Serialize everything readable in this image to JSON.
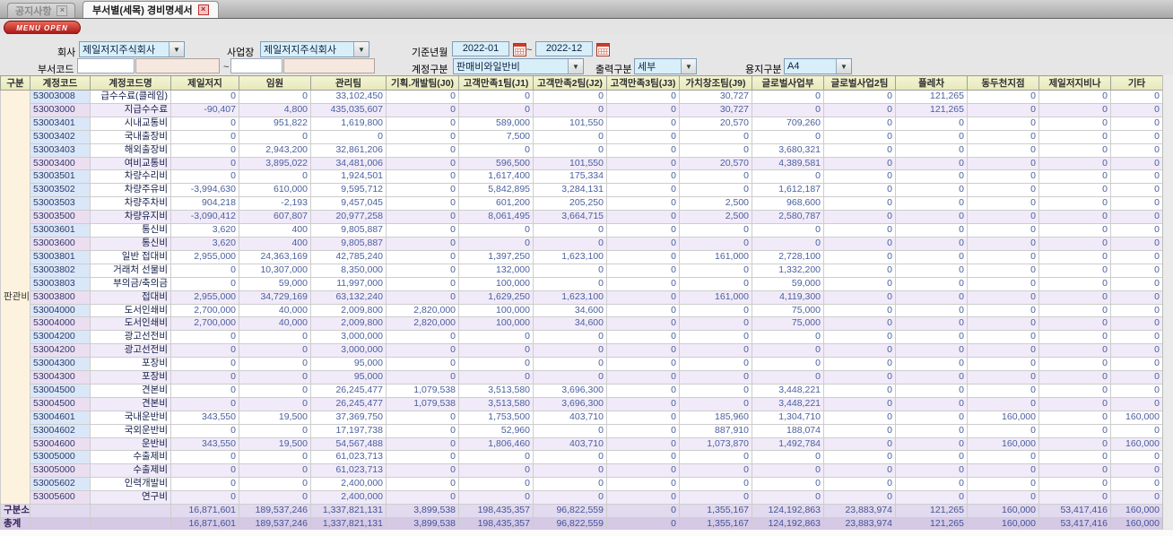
{
  "tabs": [
    {
      "label": "공지사항",
      "active": false
    },
    {
      "label": "부서별(세목) 경비명세서",
      "active": true
    }
  ],
  "menu_button": "MENU OPEN",
  "filters": {
    "company_label": "회사",
    "company_value": "제일저지주식회사",
    "site_label": "사업장",
    "site_value": "제일저지주식회사",
    "period_label": "기준년월",
    "period_from": "2022-01",
    "period_to": "2022-12",
    "tilde": "~",
    "dept_label": "부서코드",
    "account_label": "계정구분",
    "account_value": "판매비와일반비",
    "output_label": "출력구분",
    "output_value": "세부",
    "paper_label": "용지구분",
    "paper_value": "A4"
  },
  "table": {
    "columns": [
      "구분",
      "계정코드",
      "계정코드명",
      "제일저지",
      "임원",
      "관리팀",
      "기획.개발팀(J0)",
      "고객만족1팀(J1)",
      "고객만족2팀(J2)",
      "고객만족3팀(J3)",
      "가치창조팀(J9)",
      "글로벌사업부",
      "글로벌사업2팀",
      "플레차",
      "동두천지점",
      "제일저지비나",
      "기타"
    ],
    "group_label": "판관비",
    "rows": [
      {
        "code": "53003008",
        "name": "급수수료(클레임)",
        "type": "n",
        "values": [
          "0",
          "0",
          "33,102,450",
          "0",
          "0",
          "0",
          "0",
          "30,727",
          "0",
          "0",
          "121,265",
          "0",
          "0",
          "0"
        ]
      },
      {
        "code": "53003000",
        "name": "지급수수료",
        "type": "s",
        "values": [
          "-90,407",
          "4,800",
          "435,035,607",
          "0",
          "0",
          "0",
          "0",
          "30,727",
          "0",
          "0",
          "121,265",
          "0",
          "0",
          "0"
        ]
      },
      {
        "code": "53003401",
        "name": "시내교통비",
        "type": "n",
        "values": [
          "0",
          "951,822",
          "1,619,800",
          "0",
          "589,000",
          "101,550",
          "0",
          "20,570",
          "709,260",
          "0",
          "0",
          "0",
          "0",
          "0"
        ]
      },
      {
        "code": "53003402",
        "name": "국내출장비",
        "type": "n",
        "values": [
          "0",
          "0",
          "0",
          "0",
          "7,500",
          "0",
          "0",
          "0",
          "0",
          "0",
          "0",
          "0",
          "0",
          "0"
        ]
      },
      {
        "code": "53003403",
        "name": "해외출장비",
        "type": "n",
        "values": [
          "0",
          "2,943,200",
          "32,861,206",
          "0",
          "0",
          "0",
          "0",
          "0",
          "3,680,321",
          "0",
          "0",
          "0",
          "0",
          "0"
        ]
      },
      {
        "code": "53003400",
        "name": "여비교통비",
        "type": "s",
        "values": [
          "0",
          "3,895,022",
          "34,481,006",
          "0",
          "596,500",
          "101,550",
          "0",
          "20,570",
          "4,389,581",
          "0",
          "0",
          "0",
          "0",
          "0"
        ]
      },
      {
        "code": "53003501",
        "name": "차량수리비",
        "type": "n",
        "values": [
          "0",
          "0",
          "1,924,501",
          "0",
          "1,617,400",
          "175,334",
          "0",
          "0",
          "0",
          "0",
          "0",
          "0",
          "0",
          "0"
        ]
      },
      {
        "code": "53003502",
        "name": "차량주유비",
        "type": "n",
        "values": [
          "-3,994,630",
          "610,000",
          "9,595,712",
          "0",
          "5,842,895",
          "3,284,131",
          "0",
          "0",
          "1,612,187",
          "0",
          "0",
          "0",
          "0",
          "0"
        ]
      },
      {
        "code": "53003503",
        "name": "차량주차비",
        "type": "n",
        "values": [
          "904,218",
          "-2,193",
          "9,457,045",
          "0",
          "601,200",
          "205,250",
          "0",
          "2,500",
          "968,600",
          "0",
          "0",
          "0",
          "0",
          "0"
        ]
      },
      {
        "code": "53003500",
        "name": "차량유지비",
        "type": "s",
        "values": [
          "-3,090,412",
          "607,807",
          "20,977,258",
          "0",
          "8,061,495",
          "3,664,715",
          "0",
          "2,500",
          "2,580,787",
          "0",
          "0",
          "0",
          "0",
          "0"
        ]
      },
      {
        "code": "53003601",
        "name": "통신비",
        "type": "n",
        "values": [
          "3,620",
          "400",
          "9,805,887",
          "0",
          "0",
          "0",
          "0",
          "0",
          "0",
          "0",
          "0",
          "0",
          "0",
          "0"
        ]
      },
      {
        "code": "53003600",
        "name": "통신비",
        "type": "s",
        "values": [
          "3,620",
          "400",
          "9,805,887",
          "0",
          "0",
          "0",
          "0",
          "0",
          "0",
          "0",
          "0",
          "0",
          "0",
          "0"
        ]
      },
      {
        "code": "53003801",
        "name": "일반 접대비",
        "type": "n",
        "values": [
          "2,955,000",
          "24,363,169",
          "42,785,240",
          "0",
          "1,397,250",
          "1,623,100",
          "0",
          "161,000",
          "2,728,100",
          "0",
          "0",
          "0",
          "0",
          "0"
        ]
      },
      {
        "code": "53003802",
        "name": "거래처 선물비",
        "type": "n",
        "values": [
          "0",
          "10,307,000",
          "8,350,000",
          "0",
          "132,000",
          "0",
          "0",
          "0",
          "1,332,200",
          "0",
          "0",
          "0",
          "0",
          "0"
        ]
      },
      {
        "code": "53003803",
        "name": "부의금/축의금",
        "type": "n",
        "values": [
          "0",
          "59,000",
          "11,997,000",
          "0",
          "100,000",
          "0",
          "0",
          "0",
          "59,000",
          "0",
          "0",
          "0",
          "0",
          "0"
        ]
      },
      {
        "code": "53003800",
        "name": "접대비",
        "type": "s",
        "values": [
          "2,955,000",
          "34,729,169",
          "63,132,240",
          "0",
          "1,629,250",
          "1,623,100",
          "0",
          "161,000",
          "4,119,300",
          "0",
          "0",
          "0",
          "0",
          "0"
        ]
      },
      {
        "code": "53004000",
        "name": "도서인쇄비",
        "type": "n",
        "values": [
          "2,700,000",
          "40,000",
          "2,009,800",
          "2,820,000",
          "100,000",
          "34,600",
          "0",
          "0",
          "75,000",
          "0",
          "0",
          "0",
          "0",
          "0"
        ]
      },
      {
        "code": "53004000",
        "name": "도서인쇄비",
        "type": "s",
        "values": [
          "2,700,000",
          "40,000",
          "2,009,800",
          "2,820,000",
          "100,000",
          "34,600",
          "0",
          "0",
          "75,000",
          "0",
          "0",
          "0",
          "0",
          "0"
        ]
      },
      {
        "code": "53004200",
        "name": "광고선전비",
        "type": "n",
        "values": [
          "0",
          "0",
          "3,000,000",
          "0",
          "0",
          "0",
          "0",
          "0",
          "0",
          "0",
          "0",
          "0",
          "0",
          "0"
        ]
      },
      {
        "code": "53004200",
        "name": "광고선전비",
        "type": "s",
        "values": [
          "0",
          "0",
          "3,000,000",
          "0",
          "0",
          "0",
          "0",
          "0",
          "0",
          "0",
          "0",
          "0",
          "0",
          "0"
        ]
      },
      {
        "code": "53004300",
        "name": "포장비",
        "type": "n",
        "values": [
          "0",
          "0",
          "95,000",
          "0",
          "0",
          "0",
          "0",
          "0",
          "0",
          "0",
          "0",
          "0",
          "0",
          "0"
        ]
      },
      {
        "code": "53004300",
        "name": "포장비",
        "type": "s",
        "values": [
          "0",
          "0",
          "95,000",
          "0",
          "0",
          "0",
          "0",
          "0",
          "0",
          "0",
          "0",
          "0",
          "0",
          "0"
        ]
      },
      {
        "code": "53004500",
        "name": "견본비",
        "type": "n",
        "values": [
          "0",
          "0",
          "26,245,477",
          "1,079,538",
          "3,513,580",
          "3,696,300",
          "0",
          "0",
          "3,448,221",
          "0",
          "0",
          "0",
          "0",
          "0"
        ]
      },
      {
        "code": "53004500",
        "name": "견본비",
        "type": "s",
        "values": [
          "0",
          "0",
          "26,245,477",
          "1,079,538",
          "3,513,580",
          "3,696,300",
          "0",
          "0",
          "3,448,221",
          "0",
          "0",
          "0",
          "0",
          "0"
        ]
      },
      {
        "code": "53004601",
        "name": "국내운반비",
        "type": "n",
        "values": [
          "343,550",
          "19,500",
          "37,369,750",
          "0",
          "1,753,500",
          "403,710",
          "0",
          "185,960",
          "1,304,710",
          "0",
          "0",
          "160,000",
          "0",
          "160,000"
        ]
      },
      {
        "code": "53004602",
        "name": "국외운반비",
        "type": "n",
        "values": [
          "0",
          "0",
          "17,197,738",
          "0",
          "52,960",
          "0",
          "0",
          "887,910",
          "188,074",
          "0",
          "0",
          "0",
          "0",
          "0"
        ]
      },
      {
        "code": "53004600",
        "name": "운반비",
        "type": "s",
        "values": [
          "343,550",
          "19,500",
          "54,567,488",
          "0",
          "1,806,460",
          "403,710",
          "0",
          "1,073,870",
          "1,492,784",
          "0",
          "0",
          "160,000",
          "0",
          "160,000"
        ]
      },
      {
        "code": "53005000",
        "name": "수출제비",
        "type": "n",
        "values": [
          "0",
          "0",
          "61,023,713",
          "0",
          "0",
          "0",
          "0",
          "0",
          "0",
          "0",
          "0",
          "0",
          "0",
          "0"
        ]
      },
      {
        "code": "53005000",
        "name": "수출제비",
        "type": "s",
        "values": [
          "0",
          "0",
          "61,023,713",
          "0",
          "0",
          "0",
          "0",
          "0",
          "0",
          "0",
          "0",
          "0",
          "0",
          "0"
        ]
      },
      {
        "code": "53005602",
        "name": "인력개발비",
        "type": "n",
        "values": [
          "0",
          "0",
          "2,400,000",
          "0",
          "0",
          "0",
          "0",
          "0",
          "0",
          "0",
          "0",
          "0",
          "0",
          "0"
        ]
      },
      {
        "code": "53005600",
        "name": "연구비",
        "type": "s",
        "values": [
          "0",
          "0",
          "2,400,000",
          "0",
          "0",
          "0",
          "0",
          "0",
          "0",
          "0",
          "0",
          "0",
          "0",
          "0"
        ]
      }
    ],
    "section_total": {
      "label": "구분소계",
      "values": [
        "16,871,601",
        "189,537,246",
        "1,337,821,131",
        "3,899,538",
        "198,435,357",
        "96,822,559",
        "0",
        "1,355,167",
        "124,192,863",
        "23,883,974",
        "121,265",
        "160,000",
        "53,417,416",
        "160,000"
      ]
    },
    "grand_total": {
      "label": "총계",
      "values": [
        "16,871,601",
        "189,537,246",
        "1,337,821,131",
        "3,899,538",
        "198,435,357",
        "96,822,559",
        "0",
        "1,355,167",
        "124,192,863",
        "23,883,974",
        "121,265",
        "160,000",
        "53,417,416",
        "160,000"
      ]
    }
  },
  "colors": {
    "accent_red": "#b01616",
    "field_blue": "#d8effa",
    "header_yellow": "#eceec6",
    "subtotal_lavender": "#f1eaf8",
    "total_purple": "#d5c9e5"
  }
}
